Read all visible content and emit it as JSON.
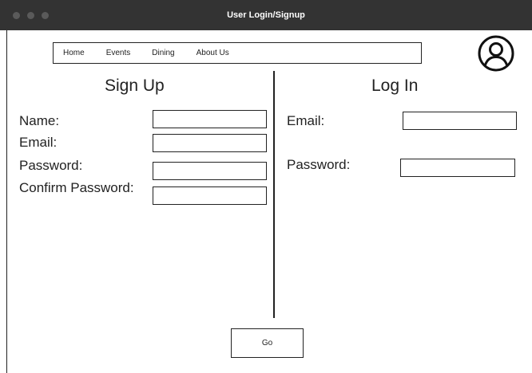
{
  "window": {
    "title": "User Login/Signup"
  },
  "nav": {
    "items": [
      {
        "label": "Home"
      },
      {
        "label": "Events"
      },
      {
        "label": "Dining"
      },
      {
        "label": "About Us"
      }
    ]
  },
  "header": {
    "avatar_icon": "user-circle-icon"
  },
  "signup": {
    "heading": "Sign Up",
    "name_label": "Name:",
    "email_label": "Email:",
    "password_label": "Password:",
    "confirm_password_label": "Confirm Password:",
    "name_value": "",
    "email_value": "",
    "password_value": "",
    "confirm_password_value": ""
  },
  "login": {
    "heading": "Log In",
    "email_label": "Email:",
    "password_label": "Password:",
    "email_value": "",
    "password_value": ""
  },
  "actions": {
    "go_label": "Go"
  }
}
